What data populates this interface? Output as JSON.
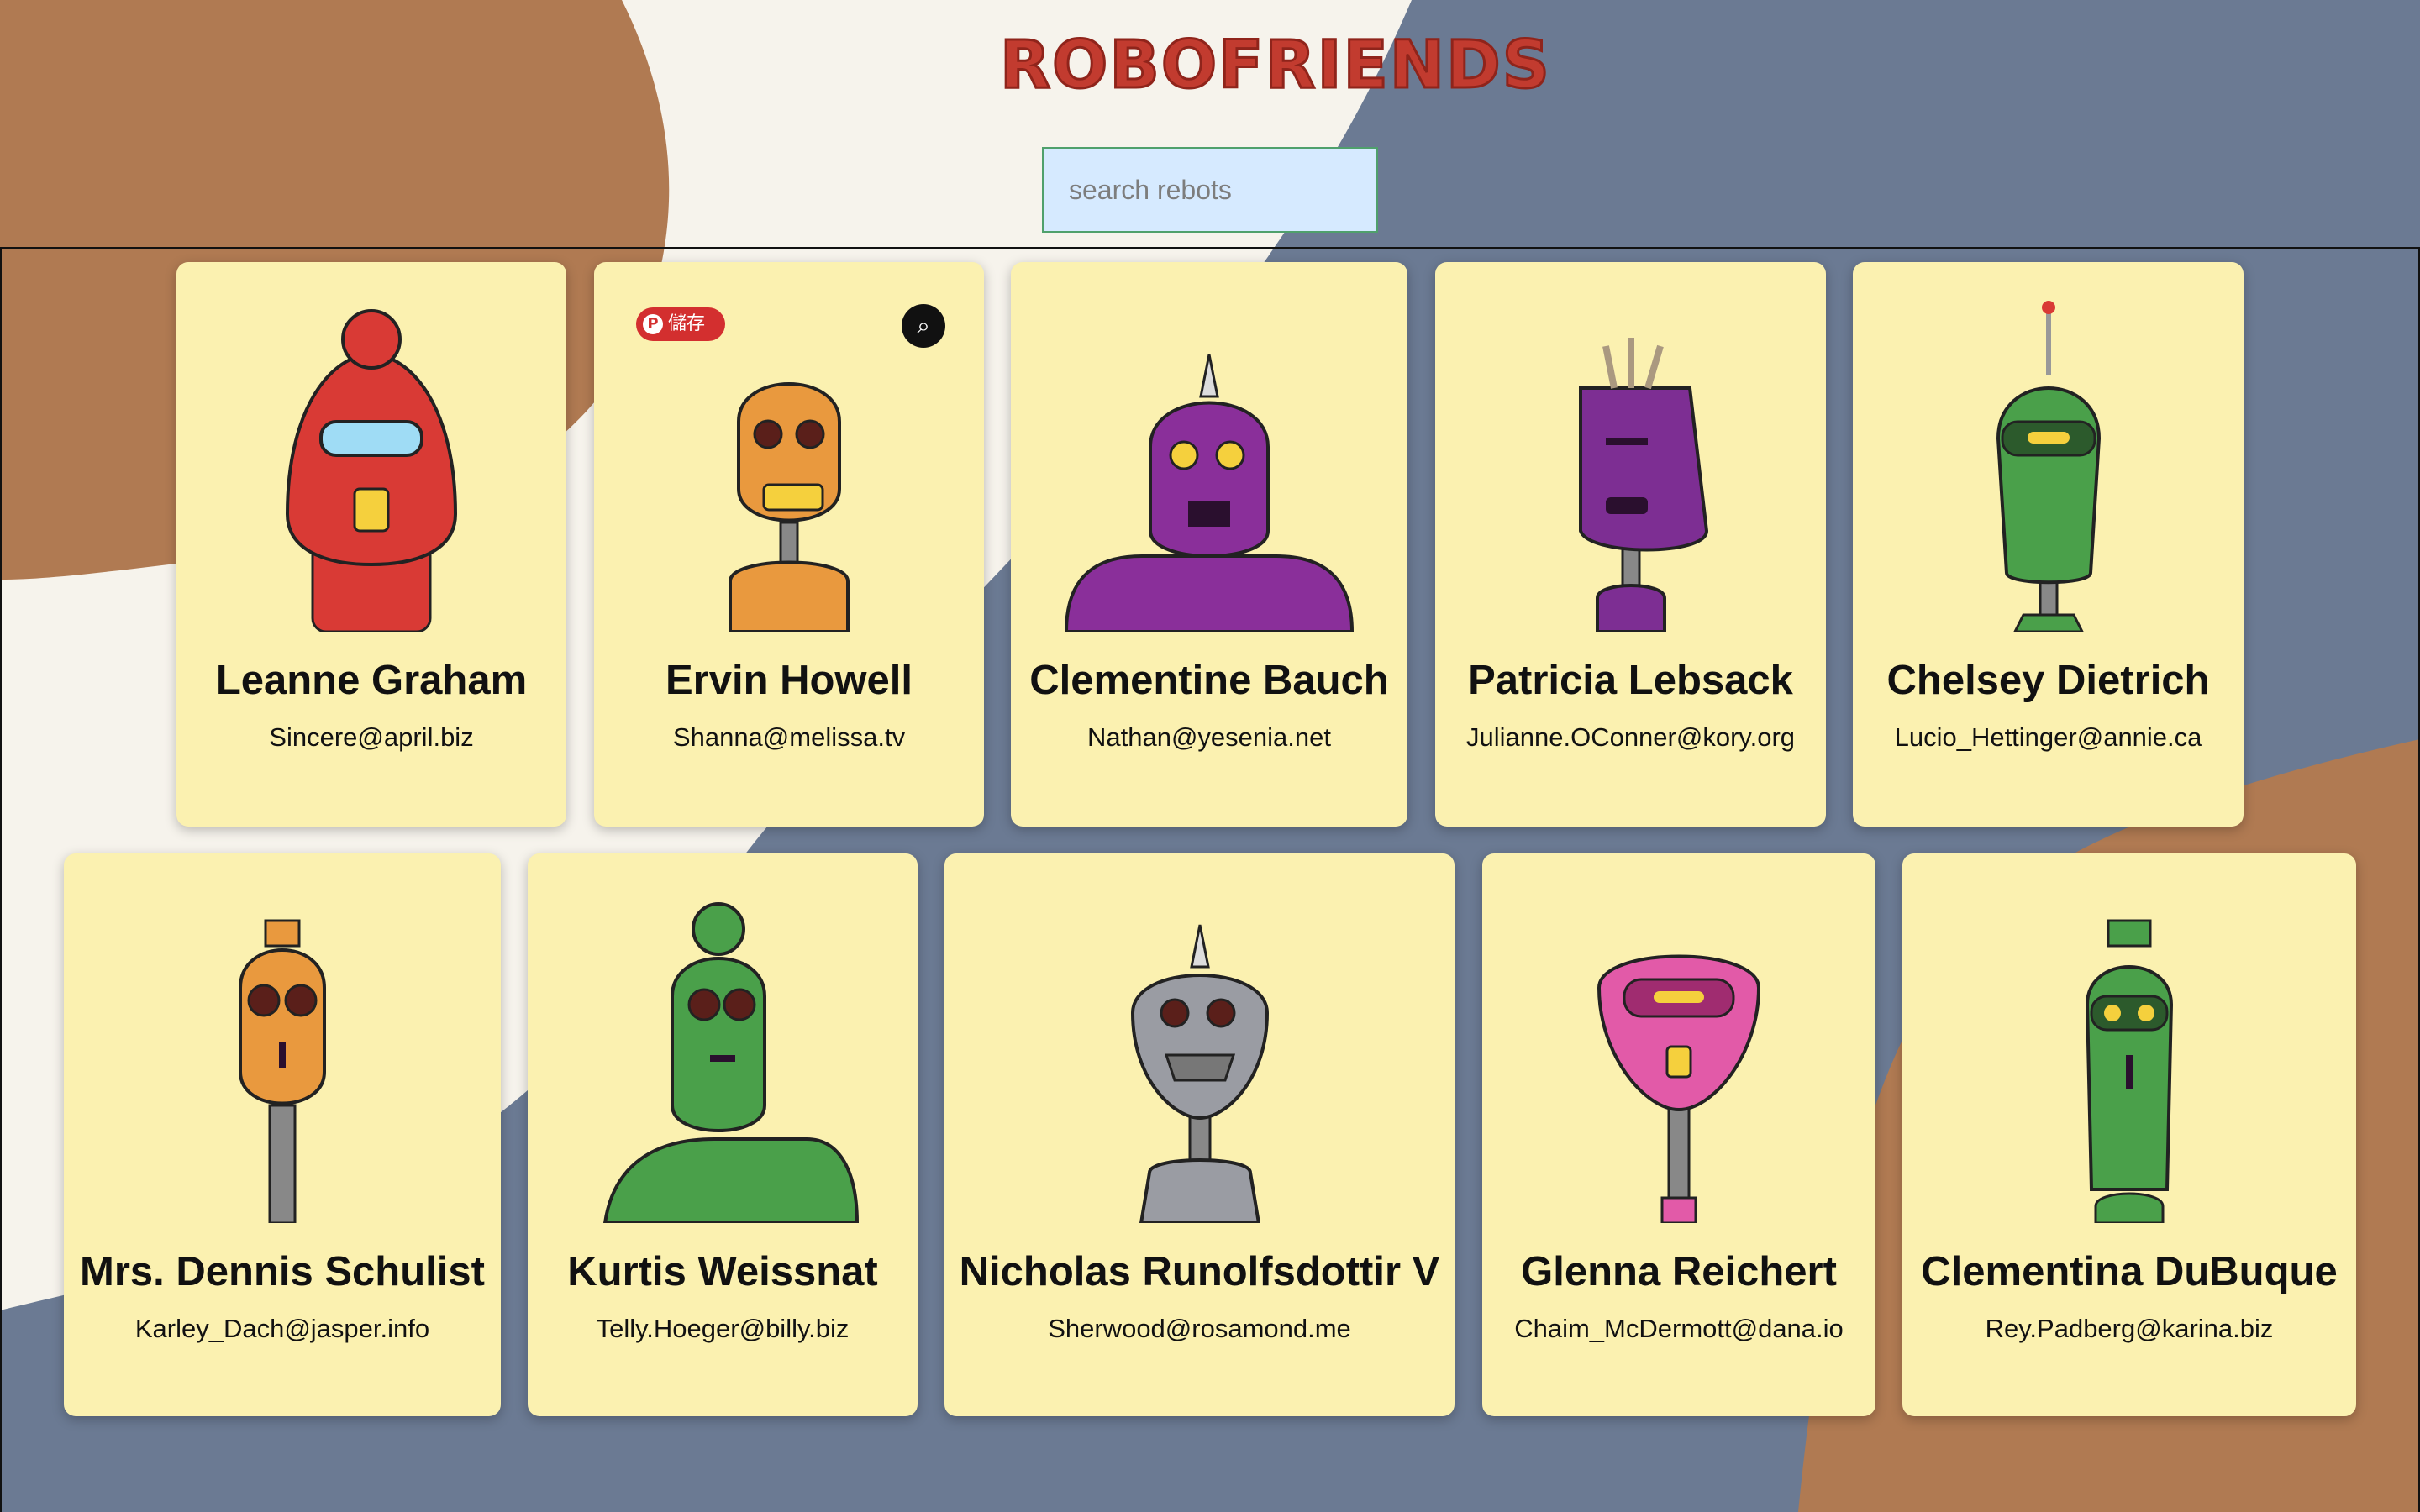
{
  "app": {
    "title": "ROBOFRIENDS"
  },
  "search": {
    "placeholder": "search rebots",
    "value": ""
  },
  "colors": {
    "background": "#6b7a93",
    "brown_blob": "#b07a52",
    "cream_blob": "#f6f3ec",
    "card": "#fbf1b0",
    "title": "#c23b2f",
    "search_bg": "#d6eaff",
    "search_border": "#4fa06c"
  },
  "pin_button": {
    "label": "儲存",
    "icon": "pinterest-icon"
  },
  "lens_button": {
    "icon": "visual-search-icon"
  },
  "robots": [
    {
      "name": "Leanne Graham",
      "email": "Sincere@april.biz",
      "color": "#d93a35"
    },
    {
      "name": "Ervin Howell",
      "email": "Shanna@melissa.tv",
      "color": "#e9993e"
    },
    {
      "name": "Clementine Bauch",
      "email": "Nathan@yesenia.net",
      "color": "#8a2f9a"
    },
    {
      "name": "Patricia Lebsack",
      "email": "Julianne.OConner@kory.org",
      "color": "#7d2e93"
    },
    {
      "name": "Chelsey Dietrich",
      "email": "Lucio_Hettinger@annie.ca",
      "color": "#4aa04a"
    },
    {
      "name": "Mrs. Dennis Schulist",
      "email": "Karley_Dach@jasper.info",
      "color": "#e9993e"
    },
    {
      "name": "Kurtis Weissnat",
      "email": "Telly.Hoeger@billy.biz",
      "color": "#4aa04a"
    },
    {
      "name": "Nicholas Runolfsdottir V",
      "email": "Sherwood@rosamond.me",
      "color": "#9a9ca3"
    },
    {
      "name": "Glenna Reichert",
      "email": "Chaim_McDermott@dana.io",
      "color": "#e25aa8"
    },
    {
      "name": "Clementina DuBuque",
      "email": "Rey.Padberg@karina.biz",
      "color": "#4aa04a"
    }
  ]
}
